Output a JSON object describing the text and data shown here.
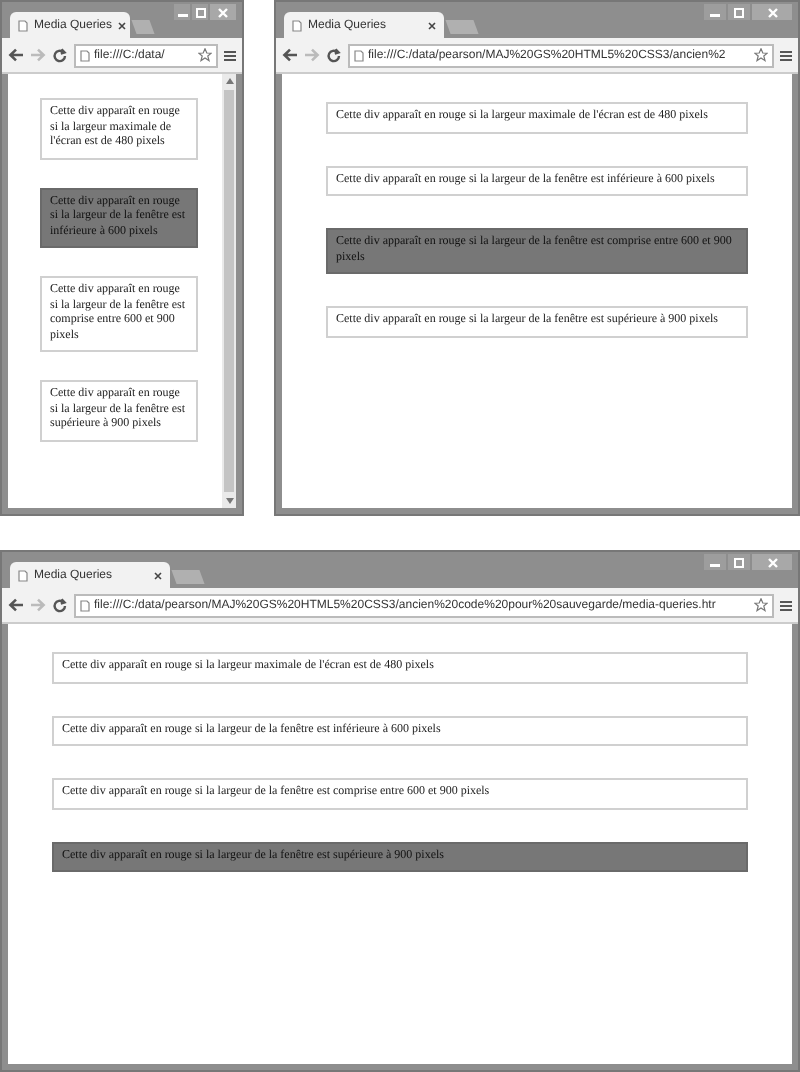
{
  "windows": [
    {
      "tab": {
        "title": "Media Queries",
        "selected": true
      },
      "url": "file:///C:/data/",
      "scrollbar": true,
      "boxes": [
        {
          "text": "Cette div apparaît en rouge si la largeur maximale de l'écran est de 480 pixels",
          "highlighted": false
        },
        {
          "text": "Cette div apparaît en rouge si la largeur de la fenêtre est inférieure à 600 pixels",
          "highlighted": true
        },
        {
          "text": "Cette div apparaît en rouge si la largeur de la fenêtre est comprise entre 600 et 900 pixels",
          "highlighted": false
        },
        {
          "text": "Cette div apparaît en rouge si la largeur de la fenêtre est supérieure à 900 pixels",
          "highlighted": false
        }
      ]
    },
    {
      "tab": {
        "title": "Media Queries",
        "selected": true
      },
      "url": "file:///C:/data/pearson/MAJ%20GS%20HTML5%20CSS3/ancien%2",
      "scrollbar": false,
      "boxes": [
        {
          "text": "Cette div apparaît en rouge si la largeur maximale de l'écran est de 480 pixels",
          "highlighted": false
        },
        {
          "text": "Cette div apparaît en rouge si la largeur de la fenêtre est inférieure à 600 pixels",
          "highlighted": false
        },
        {
          "text": "Cette div apparaît en rouge si la largeur de la fenêtre est comprise entre 600 et 900 pixels",
          "highlighted": true
        },
        {
          "text": "Cette div apparaît en rouge si la largeur de la fenêtre est supérieure à 900 pixels",
          "highlighted": false
        }
      ]
    },
    {
      "tab": {
        "title": "Media Queries",
        "selected": true
      },
      "url": "file:///C:/data/pearson/MAJ%20GS%20HTML5%20CSS3/ancien%20code%20pour%20sauvegarde/media-queries.htr",
      "scrollbar": false,
      "boxes": [
        {
          "text": "Cette div apparaît en rouge si la largeur maximale de l'écran est de 480 pixels",
          "highlighted": false
        },
        {
          "text": "Cette div apparaît en rouge si la largeur de la fenêtre est inférieure à 600 pixels",
          "highlighted": false
        },
        {
          "text": "Cette div apparaît en rouge si la largeur de la fenêtre est comprise entre 600 et 900 pixels",
          "highlighted": false
        },
        {
          "text": "Cette div apparaît en rouge si la largeur de la fenêtre est supérieure à 900 pixels",
          "highlighted": true
        }
      ]
    }
  ]
}
